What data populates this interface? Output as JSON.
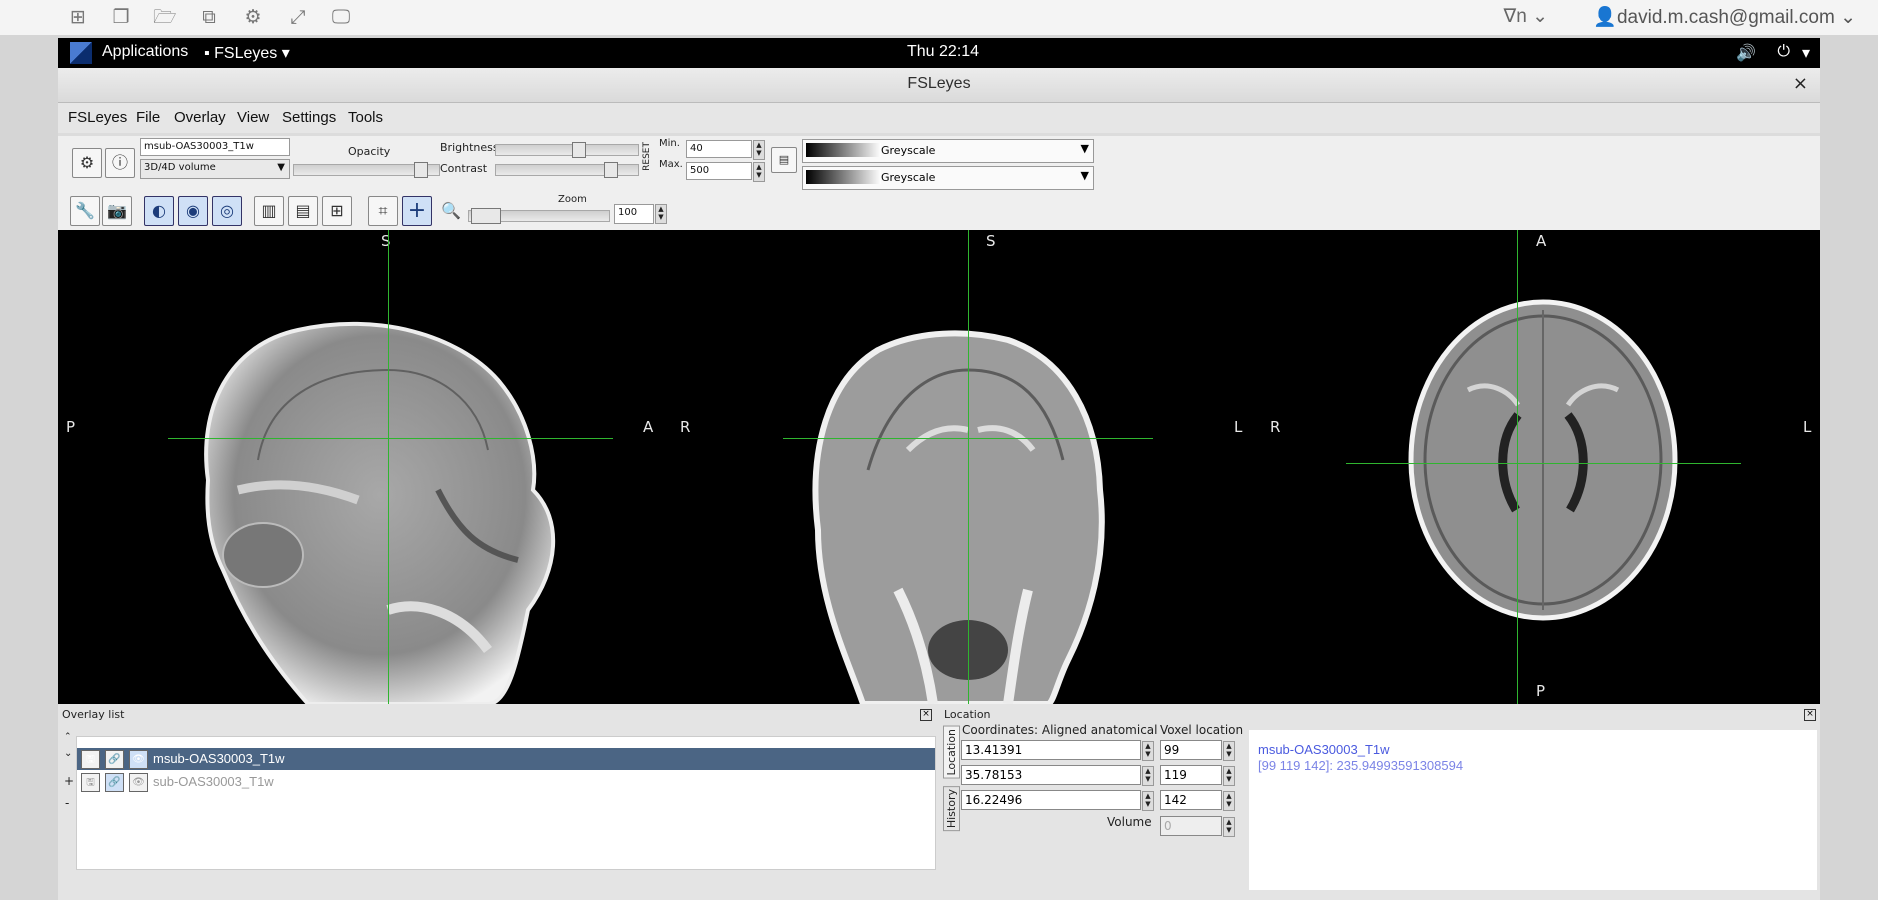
{
  "remote_bar": {
    "keyboard_label": "∇n",
    "user_email": "david.m.cash@gmail.com"
  },
  "gnome": {
    "applications": "Applications",
    "app_menu": "FSLeyes",
    "clock": "Thu 22:14"
  },
  "window": {
    "title": "FSLeyes",
    "close": "×"
  },
  "menubar": [
    "FSLeyes",
    "File",
    "Overlay",
    "View",
    "Settings",
    "Tools"
  ],
  "toolbar": {
    "overlay_name": "msub-OAS30003_T1w",
    "overlay_type": "3D/4D volume",
    "opacity_label": "Opacity",
    "brightness_label": "Brightness",
    "contrast_label": "Contrast",
    "reset_label": "RESET",
    "min_label": "Min.",
    "min_value": "40",
    "max_label": "Max.",
    "max_value": "500",
    "cmap1": "Greyscale",
    "cmap2": "Greyscale",
    "zoom_label": "Zoom",
    "zoom_value": "100"
  },
  "ortho": {
    "sagittal": {
      "top": "S",
      "left": "P",
      "right": "A"
    },
    "coronal": {
      "top": "S",
      "left": "R",
      "right": "L"
    },
    "axial": {
      "top": "A",
      "left": "R",
      "right": "L",
      "bottom": "P"
    }
  },
  "overlay_list": {
    "title": "Overlay list",
    "items": [
      {
        "name": "msub-OAS30003_T1w",
        "selected": true
      },
      {
        "name": "sub-OAS30003_T1w",
        "selected": false
      }
    ],
    "controls": {
      "up": "⌃",
      "down": "⌄",
      "add": "+",
      "remove": "-"
    }
  },
  "location": {
    "title": "Location",
    "tab_location": "Location",
    "tab_history": "History",
    "coords_label": "Coordinates: Aligned anatomical",
    "voxel_label": "Voxel location",
    "coords": [
      "13.41391",
      "35.78153",
      "16.22496"
    ],
    "voxels": [
      "99",
      "119",
      "142"
    ],
    "volume_label": "Volume",
    "volume_value": "0",
    "info_name": "msub-OAS30003_T1w",
    "info_value": "[99 119 142]: 235.94993591308594"
  },
  "colors": {
    "crosshair": "#2fb52f",
    "selected_row": "#4b6584",
    "info_text": "#4a5adf"
  }
}
